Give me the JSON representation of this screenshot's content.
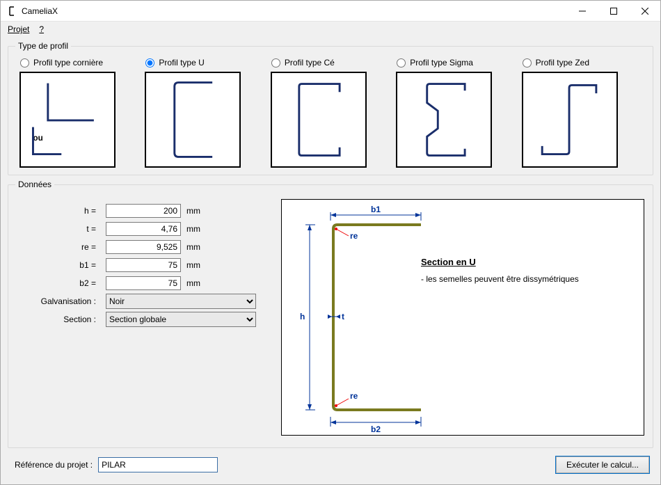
{
  "window": {
    "title": "CameliaX",
    "menu": {
      "projet": "Projet",
      "help": "?"
    }
  },
  "profiles": {
    "legend": "Type de profil",
    "items": [
      {
        "key": "corniere",
        "label": "Profil type cornière"
      },
      {
        "key": "u",
        "label": "Profil type U"
      },
      {
        "key": "ce",
        "label": "Profil type Cé"
      },
      {
        "key": "sigma",
        "label": "Profil type Sigma"
      },
      {
        "key": "zed",
        "label": "Profil type Zed"
      }
    ],
    "selected": "u",
    "corniere_ou": "ou"
  },
  "data_fieldset": {
    "legend": "Données"
  },
  "fields": {
    "h": {
      "label": "h =",
      "value": "200",
      "unit": "mm"
    },
    "t": {
      "label": "t =",
      "value": "4,76",
      "unit": "mm"
    },
    "re": {
      "label": "re =",
      "value": "9,525",
      "unit": "mm"
    },
    "b1": {
      "label": "b1 =",
      "value": "75",
      "unit": "mm"
    },
    "b2": {
      "label": "b2 =",
      "value": "75",
      "unit": "mm"
    },
    "galv": {
      "label": "Galvanisation :",
      "value": "Noir"
    },
    "section": {
      "label": "Section :",
      "value": "Section globale"
    }
  },
  "diagram": {
    "title": "Section en U",
    "note": "- les semelles peuvent être dissymétriques",
    "labels": {
      "b1": "b1",
      "b2": "b2",
      "h": "h",
      "t": "t",
      "re": "re"
    }
  },
  "footer": {
    "ref_label": "Référence du projet :",
    "ref_value": "PILAR",
    "exec_label": "Exécuter le calcul..."
  }
}
